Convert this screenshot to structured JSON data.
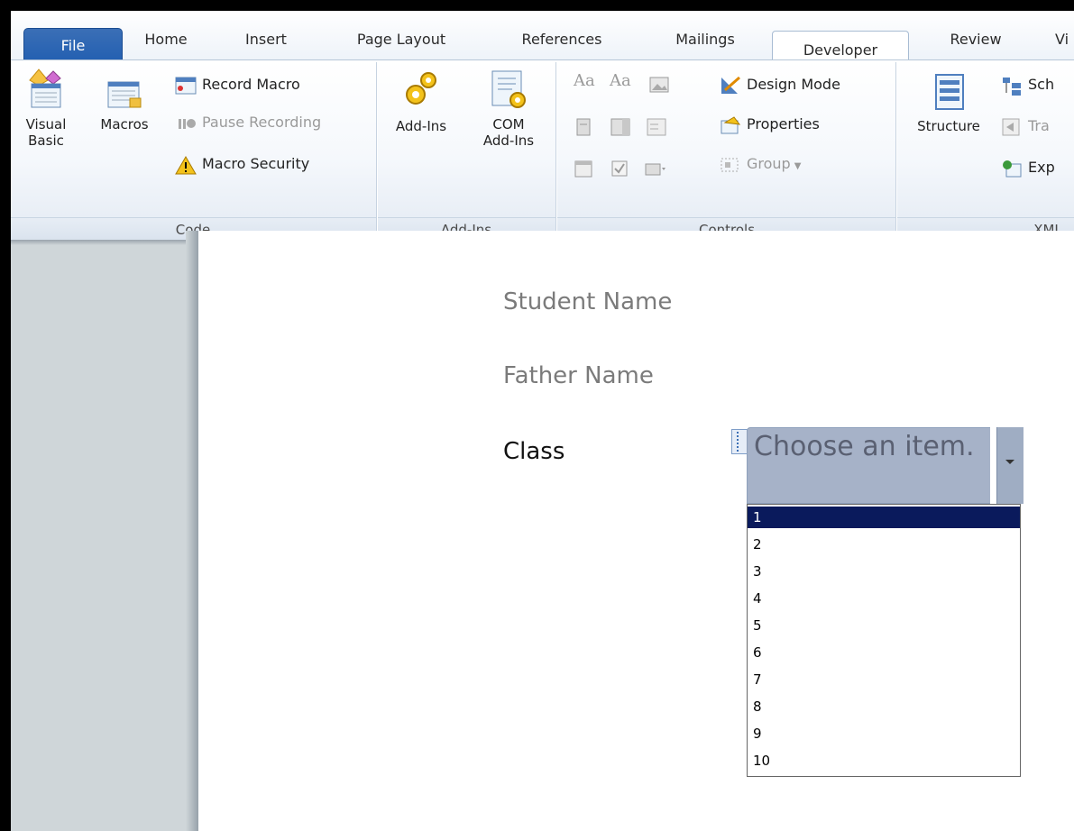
{
  "tabs": {
    "file": "File",
    "home": "Home",
    "insert": "Insert",
    "page_layout": "Page Layout",
    "references": "References",
    "mailings": "Mailings",
    "developer": "Developer",
    "review": "Review",
    "view": "Vi"
  },
  "ribbon": {
    "code": {
      "group_label": "Code",
      "visual_basic_l1": "Visual",
      "visual_basic_l2": "Basic",
      "macros": "Macros",
      "record_macro": "Record Macro",
      "pause_recording": "Pause Recording",
      "macro_security": "Macro Security"
    },
    "addins": {
      "group_label": "Add-Ins",
      "addins": "Add-Ins",
      "com_l1": "COM",
      "com_l2": "Add-Ins"
    },
    "controls": {
      "group_label": "Controls",
      "design_mode": "Design Mode",
      "properties": "Properties",
      "group": "Group",
      "aa1": "Aa",
      "aa2": "Aa"
    },
    "xml": {
      "group_label": "XML",
      "structure": "Structure",
      "schema": "Sch",
      "transform": "Tra",
      "expansion": "Exp"
    }
  },
  "document": {
    "student_name": "Student Name",
    "father_name": "Father Name",
    "class_label": "Class",
    "dropdown_value": "Choose an item.",
    "options": [
      "1",
      "2",
      "3",
      "4",
      "5",
      "6",
      "7",
      "8",
      "9",
      "10"
    ],
    "selected_option": "1"
  },
  "colors": {
    "file_tab": "#1c5bb0",
    "selection": "#0a1a5c",
    "control_bg": "#a6b2c8"
  }
}
